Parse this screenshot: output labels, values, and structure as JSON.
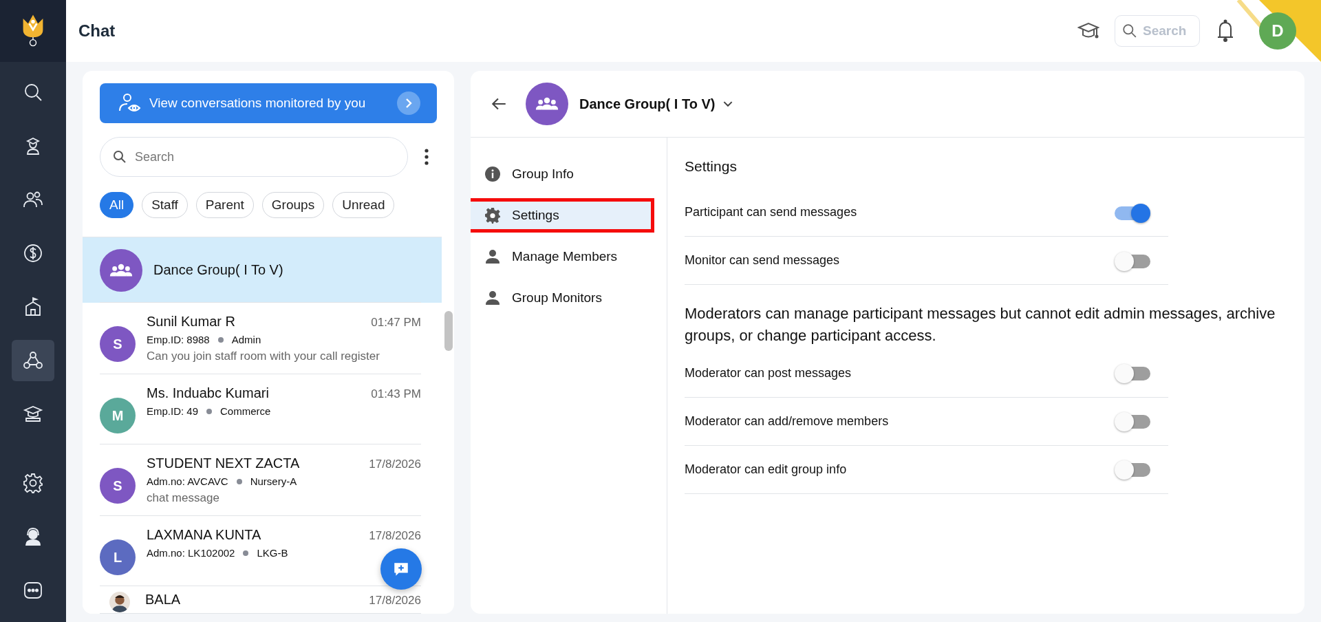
{
  "header": {
    "title": "Chat",
    "search": {
      "placeholder": "Search"
    },
    "avatar": "D"
  },
  "nav": [
    {
      "selected": false
    },
    {
      "selected": false
    },
    {
      "selected": false
    },
    {
      "selected": false
    },
    {
      "selected": false
    },
    {
      "selected": true
    },
    {
      "selected": false
    },
    {
      "selected": false
    },
    {
      "selected": false
    },
    {
      "selected": false
    }
  ],
  "chat_list": {
    "banner": "View conversations monitored by you",
    "search": {
      "placeholder": "Search"
    },
    "filters": [
      {
        "label": "All",
        "selected": true
      },
      {
        "label": "Staff",
        "selected": false
      },
      {
        "label": "Parent",
        "selected": false
      },
      {
        "label": "Groups",
        "selected": false
      },
      {
        "label": "Unread",
        "selected": false
      }
    ],
    "conversations": [
      {
        "kind": "group",
        "name": "Dance Group( I To V)",
        "selected": true,
        "color": "#7e57c2"
      },
      {
        "kind": "person",
        "initial": "S",
        "name": "Sunil Kumar R",
        "time": "01:47 PM",
        "id": "Emp.ID: 8988",
        "role": "Admin",
        "message": "Can you join staff room with your call register",
        "selected": false,
        "color": "#7e57c2"
      },
      {
        "kind": "person",
        "initial": "M",
        "name": "Ms. Induabc Kumari",
        "time": "01:43 PM",
        "id": "Emp.ID: 49",
        "role": "Commerce",
        "selected": false,
        "color": "#5aa99a"
      },
      {
        "kind": "person",
        "initial": "S",
        "name": "STUDENT NEXT ZACTA",
        "time": "17/8/2026",
        "id": "Adm.no: AVCAVC",
        "role": "Nursery-A",
        "message": "chat message",
        "selected": false,
        "color": "#7e57c2"
      },
      {
        "kind": "person",
        "initial": "L",
        "name": "LAXMANA KUNTA",
        "time": "17/8/2026",
        "id": "Adm.no: LK102002",
        "role": "LKG-B",
        "selected": false,
        "color": "#5c6bc0"
      },
      {
        "name": "BALA",
        "time": "17/8/2026",
        "selected": false
      }
    ]
  },
  "group": {
    "name": "Dance Group( I To V)",
    "menu": [
      {
        "label": "Group Info",
        "selected": false
      },
      {
        "label": "Settings",
        "selected": true
      },
      {
        "label": "Manage Members",
        "selected": false
      },
      {
        "label": "Group Monitors",
        "selected": false
      }
    ],
    "settings_title": "Settings",
    "settings": [
      {
        "kind": "toggle",
        "label": "Participant can send messages",
        "on": true
      },
      {
        "kind": "toggle",
        "label": "Monitor can send messages",
        "on": false
      },
      {
        "kind": "note",
        "text": "Moderators can manage participant messages but cannot edit admin messages, archive groups, or change participant access."
      },
      {
        "kind": "toggle",
        "label": "Moderator can post messages",
        "on": false
      },
      {
        "kind": "toggle",
        "label": "Moderator can add/remove members",
        "on": false
      },
      {
        "kind": "toggle",
        "label": "Moderator can edit group info",
        "on": false
      }
    ]
  }
}
